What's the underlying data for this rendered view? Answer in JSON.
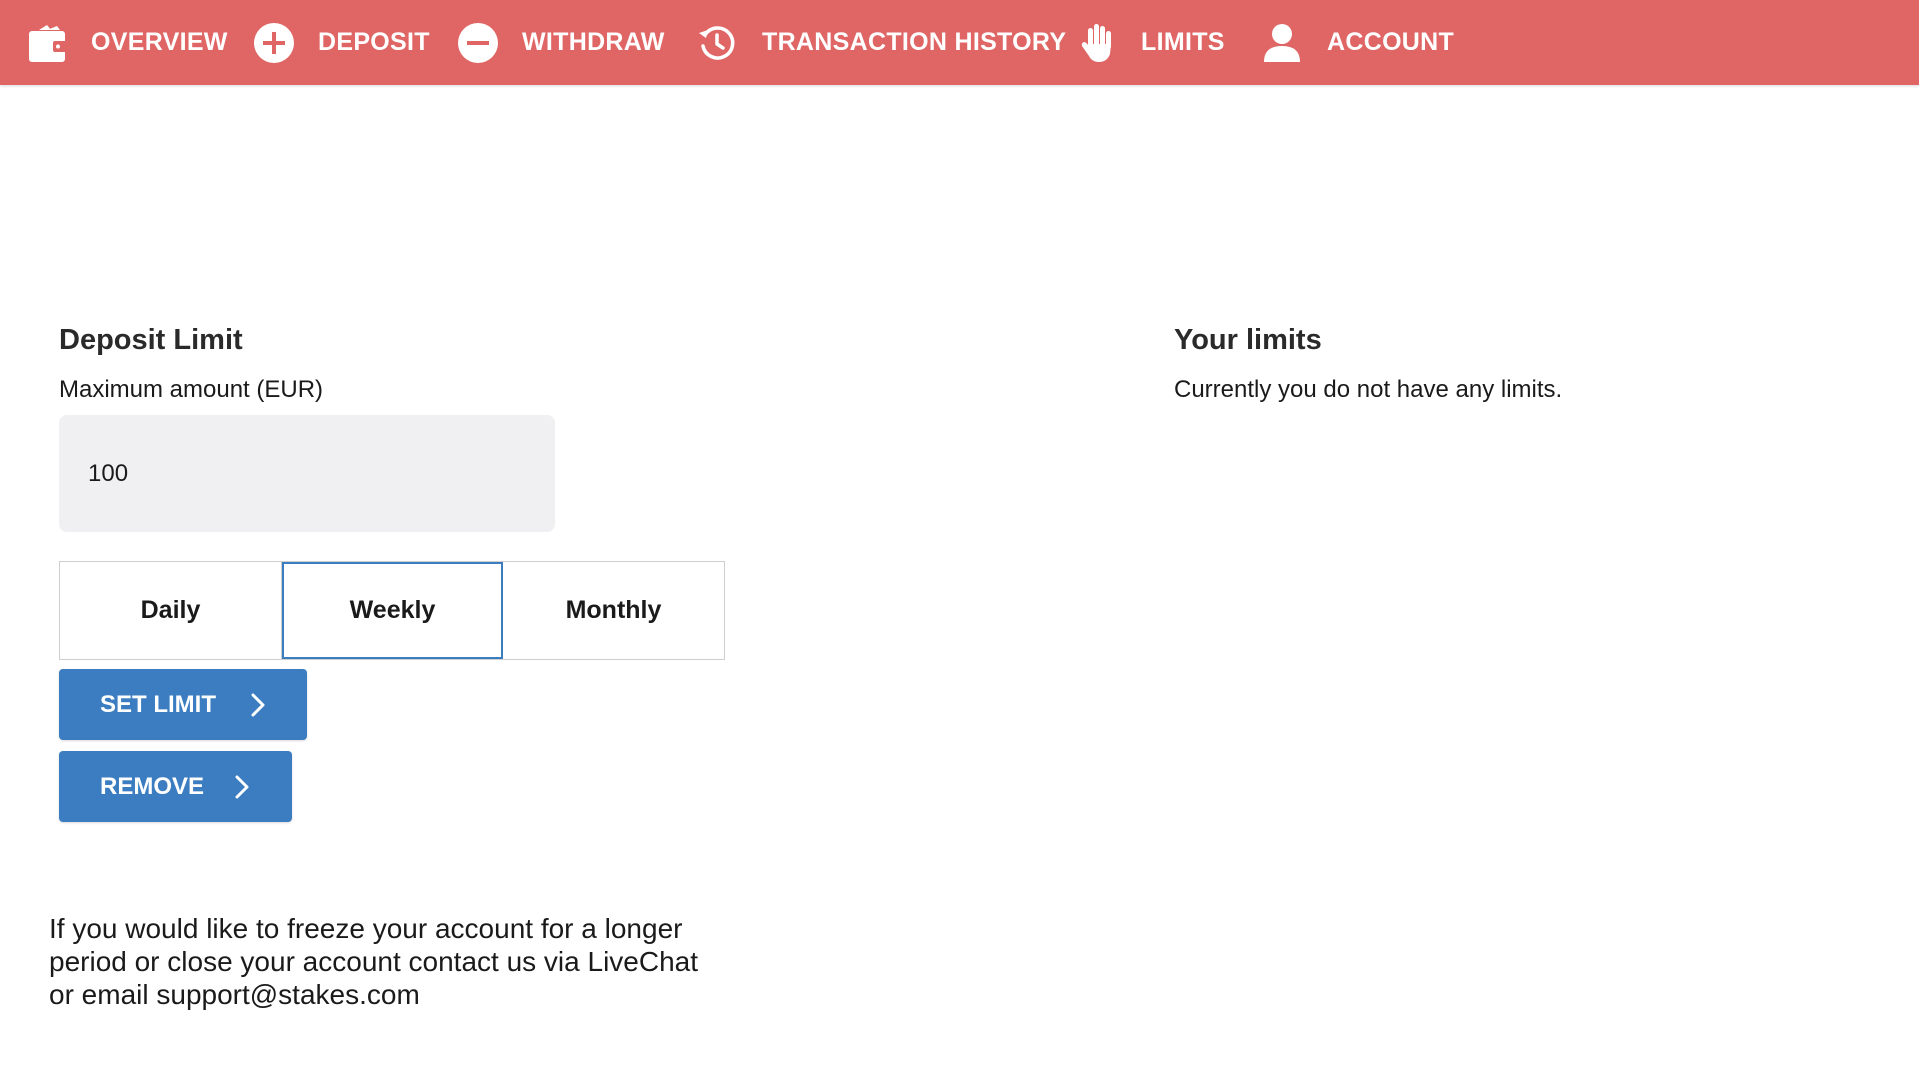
{
  "nav": {
    "items": [
      {
        "label": "OVERVIEW",
        "icon": "wallet-icon"
      },
      {
        "label": "DEPOSIT",
        "icon": "plus-circle-icon"
      },
      {
        "label": "WITHDRAW",
        "icon": "minus-circle-icon"
      },
      {
        "label": "TRANSACTION HISTORY",
        "icon": "history-icon"
      },
      {
        "label": "LIMITS",
        "icon": "hand-icon"
      },
      {
        "label": "ACCOUNT",
        "icon": "user-icon"
      }
    ],
    "background": "#e06666"
  },
  "deposit_limit": {
    "title": "Deposit Limit",
    "amount_label": "Maximum amount (EUR)",
    "amount_value": "100",
    "periods": [
      "Daily",
      "Weekly",
      "Monthly"
    ],
    "selected_period": "Weekly",
    "set_limit_label": "SET LIMIT",
    "remove_label": "REMOVE",
    "accent": "#3b7dc0"
  },
  "your_limits": {
    "title": "Your limits",
    "status": "Currently you do not have any limits."
  },
  "footer_note": {
    "line1": "If you would like to freeze your account for a longer",
    "line2": "period or close your account contact us via LiveChat",
    "line3": "or email support@stakes.com"
  }
}
